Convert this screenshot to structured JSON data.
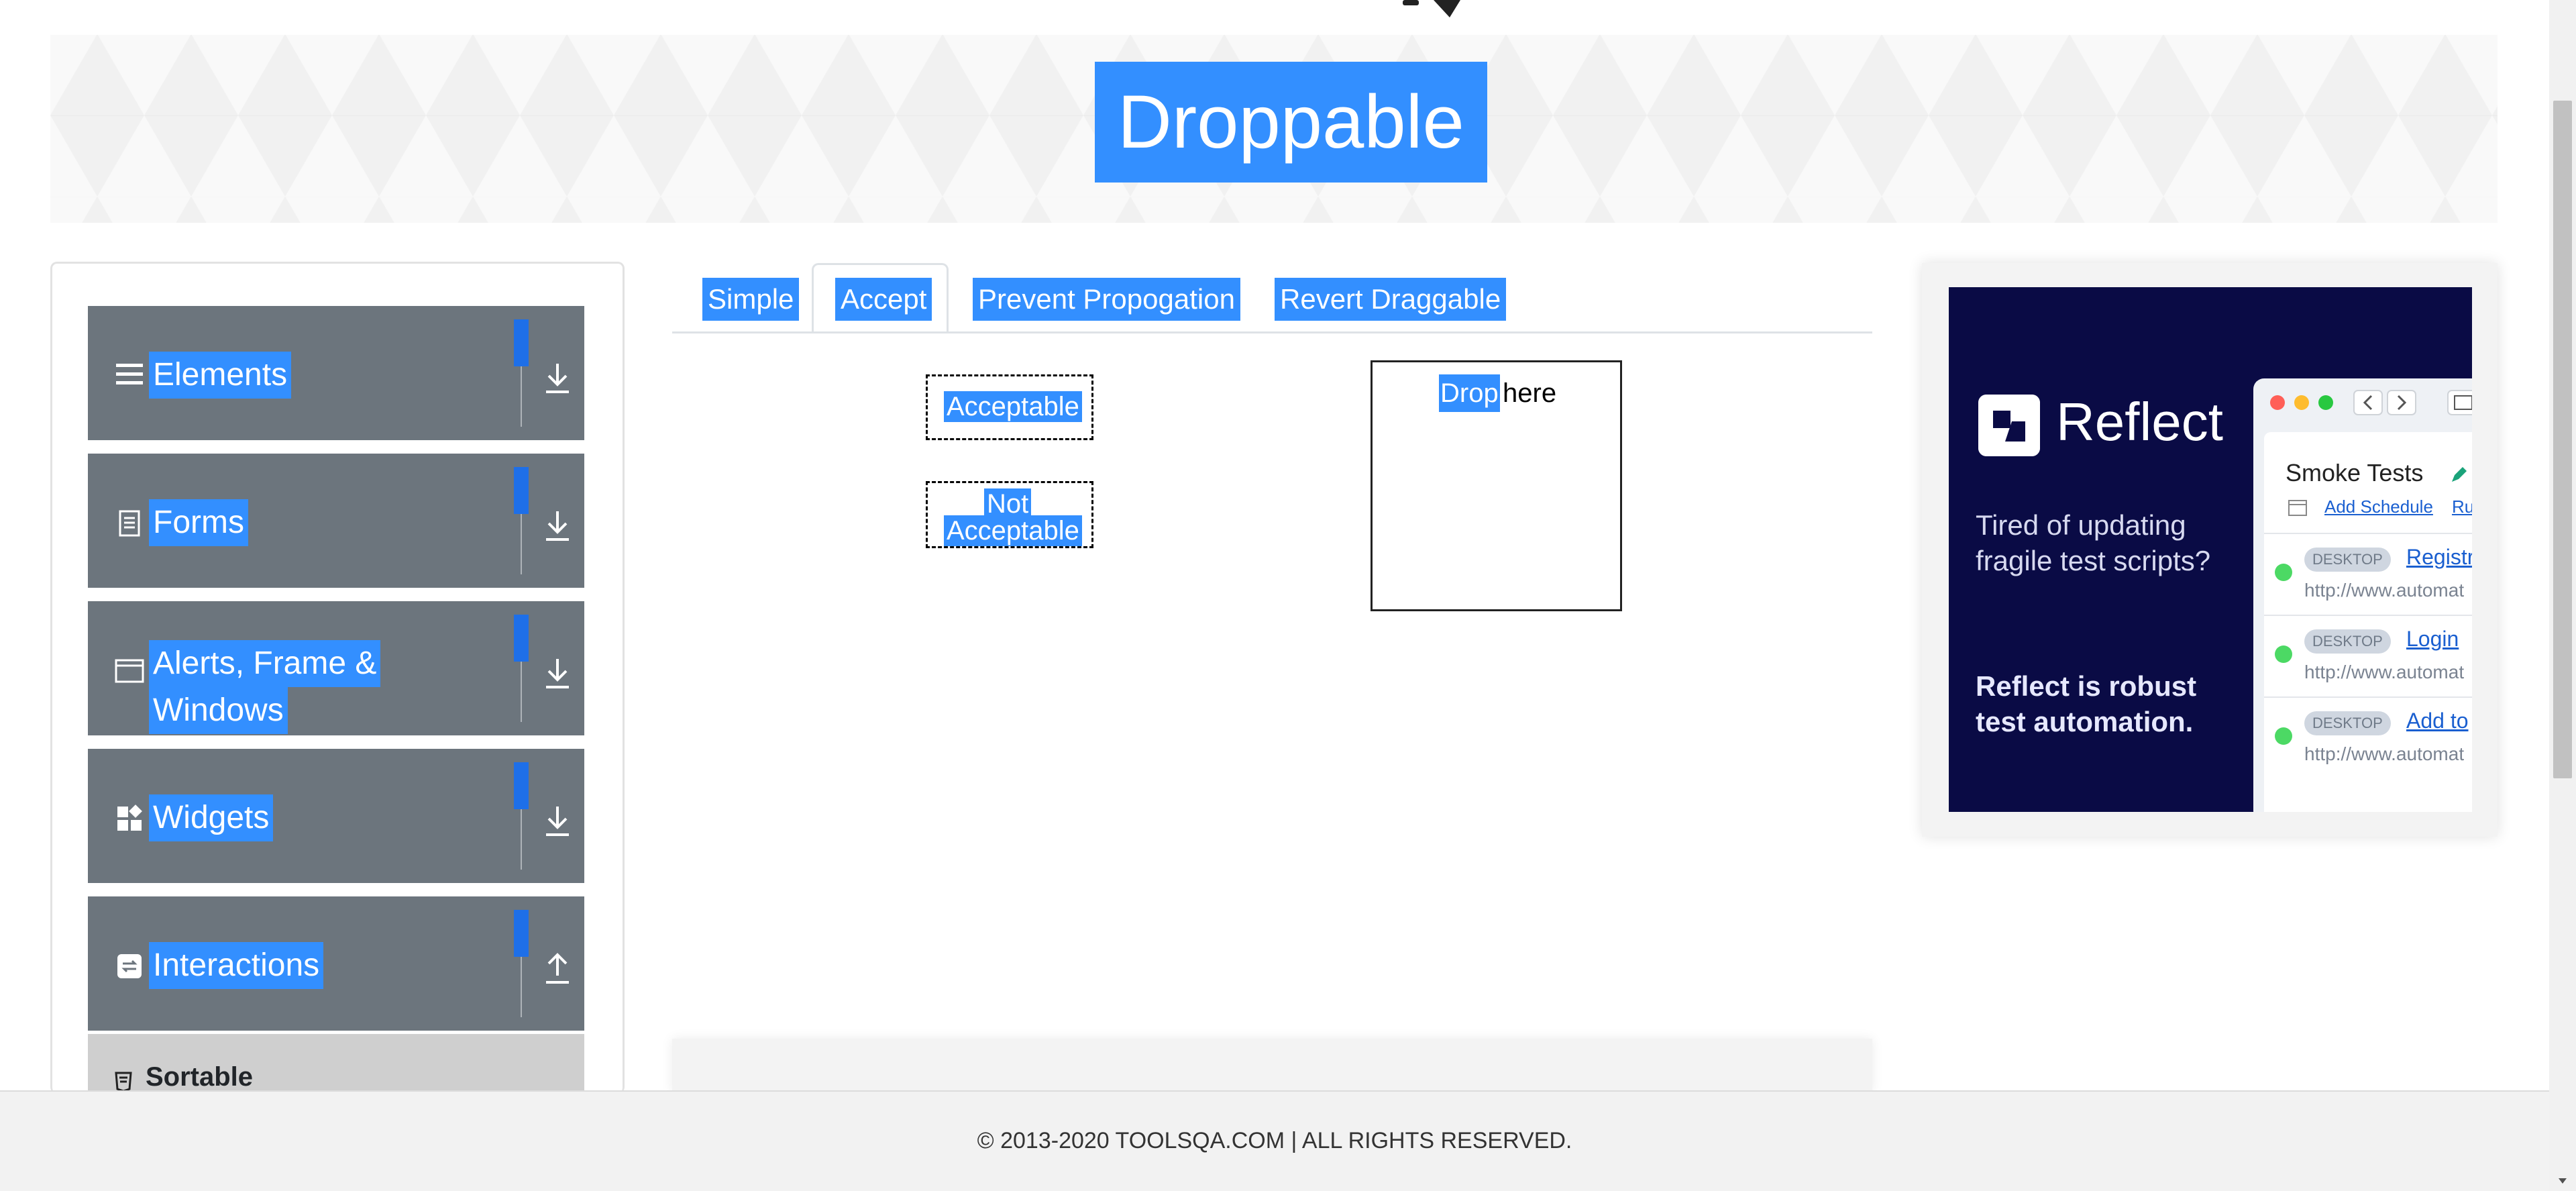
{
  "banner": {
    "title": "Droppable"
  },
  "sidebar": {
    "groups": [
      {
        "label": "Elements",
        "icon": "menu-icon"
      },
      {
        "label": "Forms",
        "icon": "document-icon"
      },
      {
        "label": "Alerts, Frame &",
        "label2": "Windows",
        "icon": "window-icon"
      },
      {
        "label": "Widgets",
        "icon": "widgets-icon"
      },
      {
        "label": "Interactions",
        "icon": "interactions-icon"
      }
    ],
    "sub_item": {
      "label": "Sortable",
      "icon": "html-icon"
    }
  },
  "tabs": [
    {
      "label": "Simple"
    },
    {
      "label": "Accept",
      "active": true
    },
    {
      "label": "Prevent Propogation"
    },
    {
      "label": "Revert Draggable"
    }
  ],
  "draggables": {
    "acceptable": "Acceptable",
    "not_acceptable_1": "Not",
    "not_acceptable_2": "Acceptable"
  },
  "drop_box": {
    "word1": "Drop",
    "word2": "here"
  },
  "ad": {
    "brand": "Reflect",
    "tagline": "Tired of updating fragile test scripts?",
    "tagline2": "Reflect is robust test automation.",
    "panel_title": "Smoke Tests",
    "add_schedule": "Add Schedule",
    "run": "Ru",
    "rows": [
      {
        "badge": "DESKTOP",
        "link": "Registr",
        "url": "http://www.automat"
      },
      {
        "badge": "DESKTOP",
        "link": "Login",
        "url": "http://www.automat"
      },
      {
        "badge": "DESKTOP",
        "link": "Add to",
        "url": "http://www.automat"
      }
    ]
  },
  "footer": {
    "text": "© 2013-2020 TOOLSQA.COM | ALL RIGHTS RESERVED."
  },
  "colors": {
    "selection": "#338fff",
    "group_bg": "#6c757d",
    "ad_bg": "#0a0b45"
  }
}
